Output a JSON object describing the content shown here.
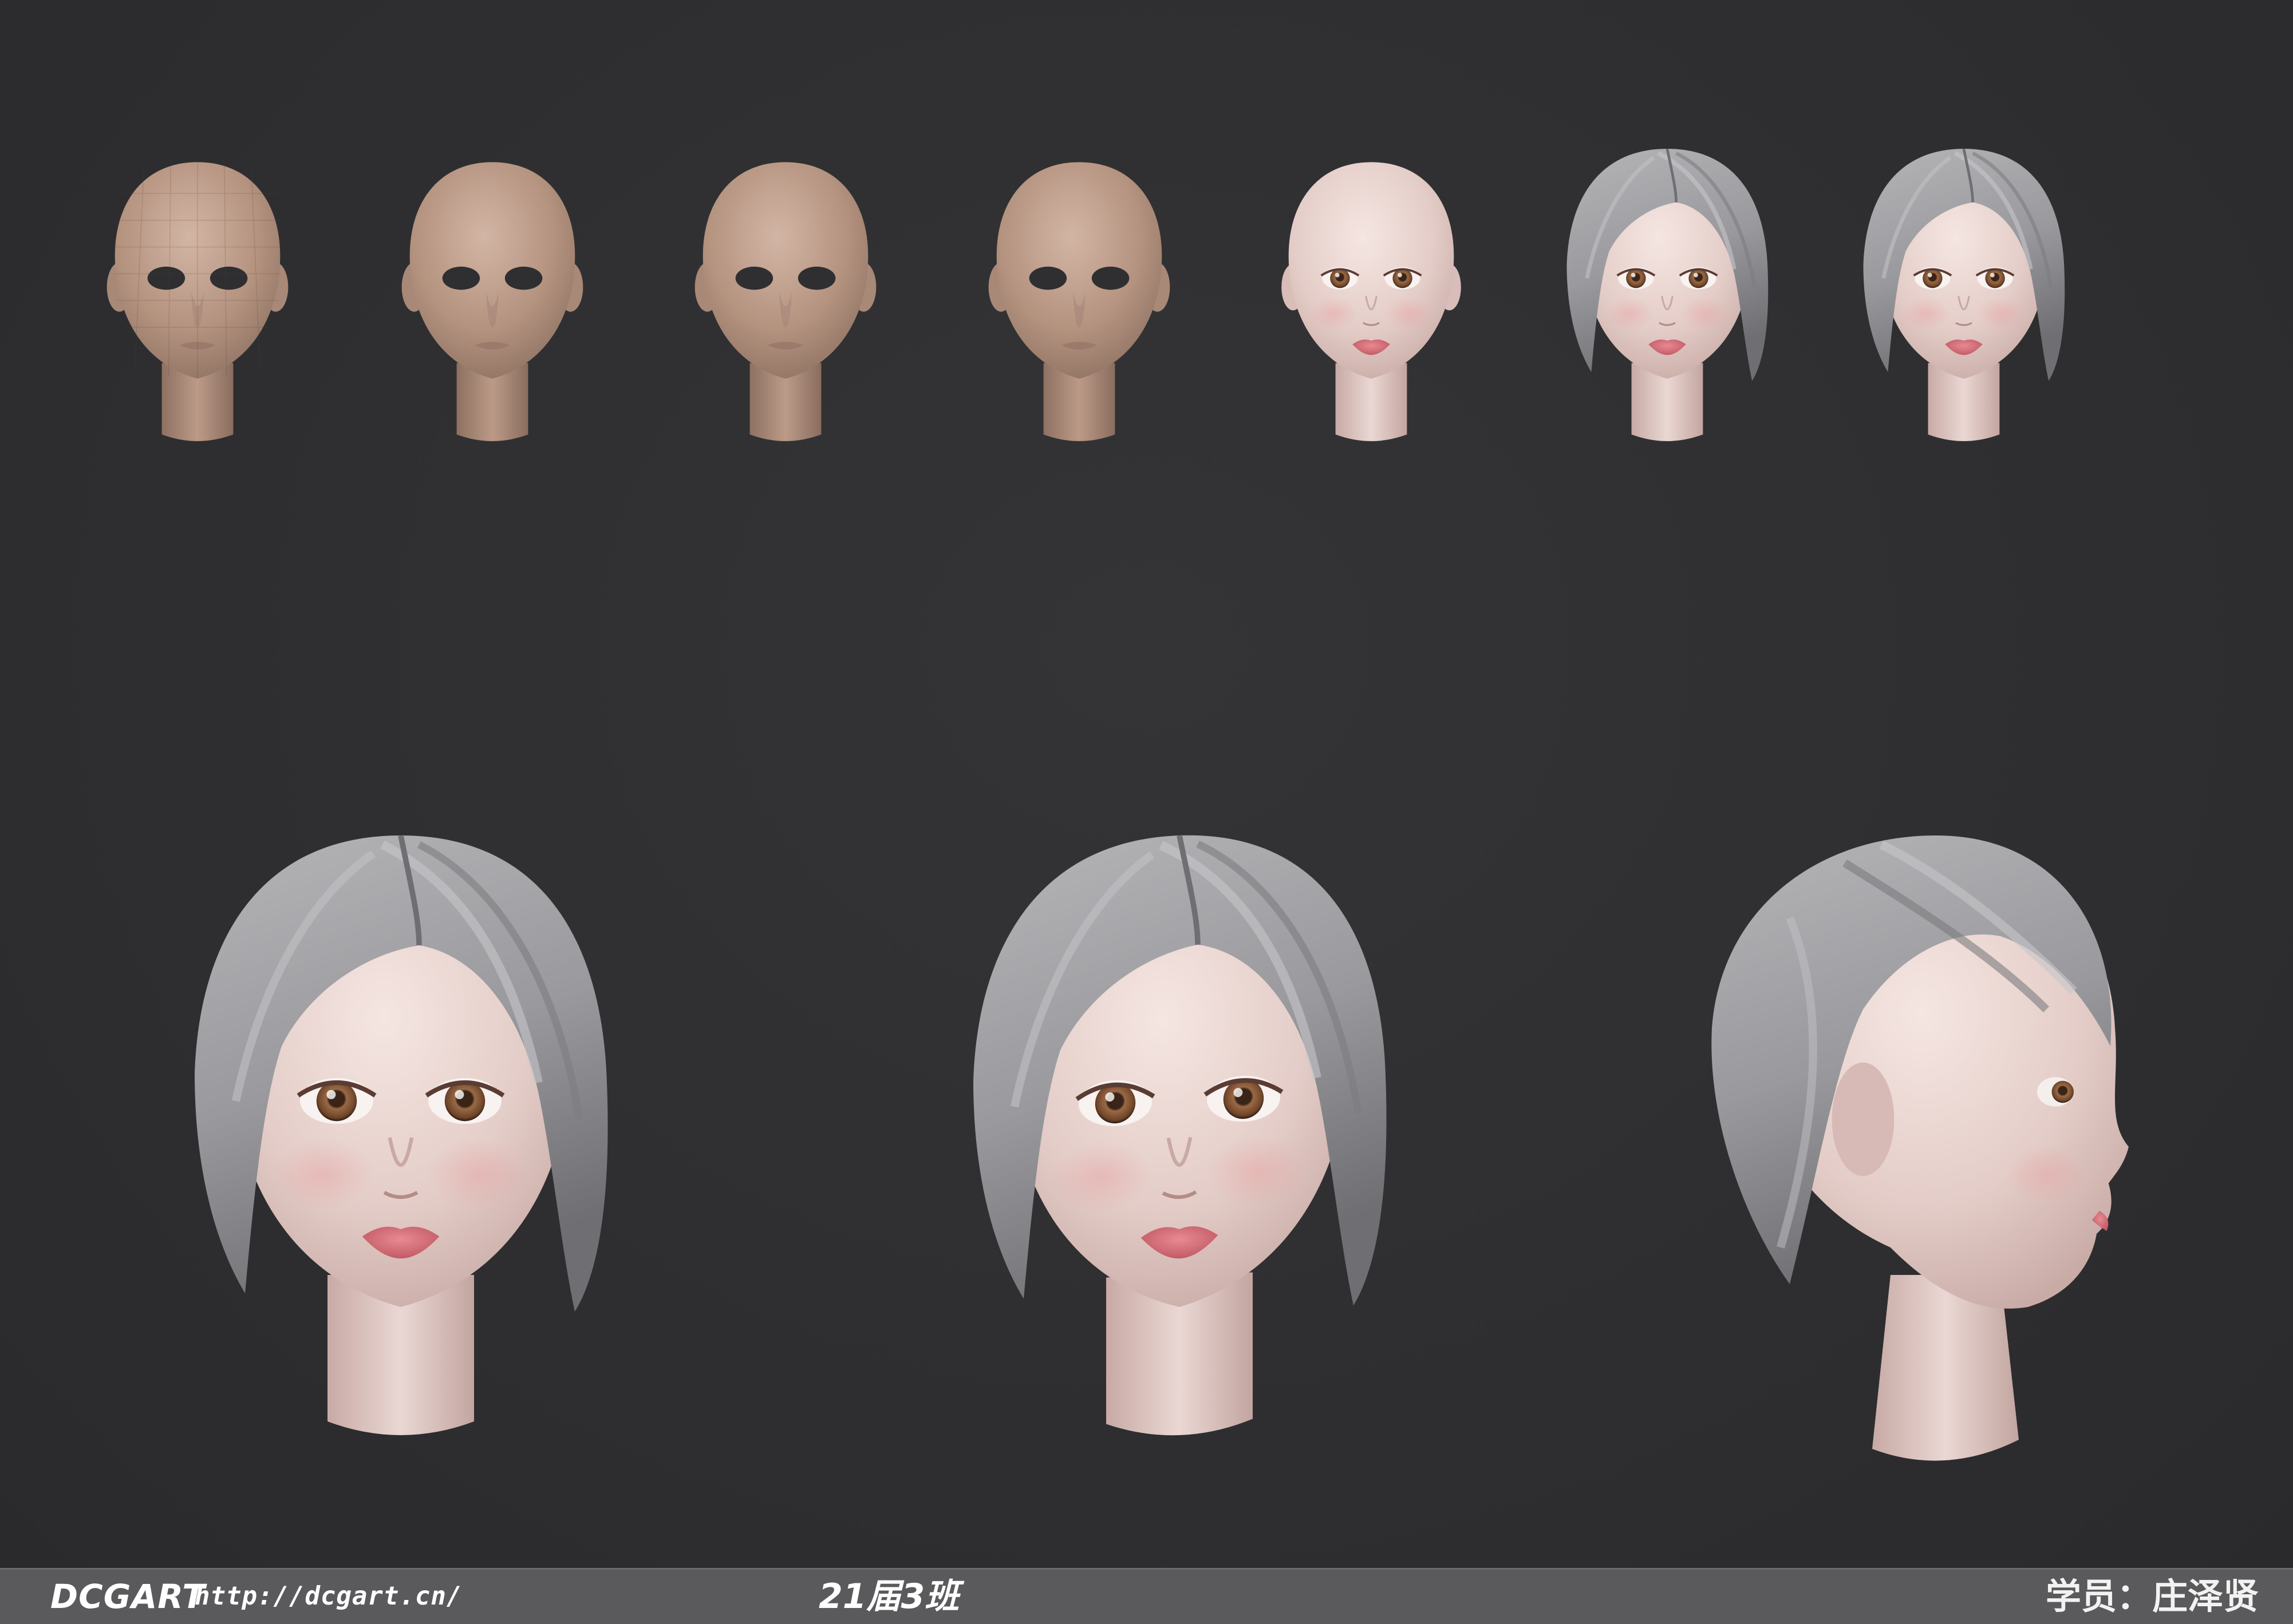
{
  "footer": {
    "brand": "DCGART",
    "url": "http://dcgart.cn/",
    "class_label": "21届3班",
    "student": "学员：庄泽贤"
  },
  "colors": {
    "background": "#2f2f31",
    "clay": "#b8998a",
    "skin": "#e6d3cf",
    "hair": "#9a9a9e",
    "lips": "#d9707a",
    "iris": "#8a5a3a",
    "footer_bar": "#5a5a5c"
  },
  "stages": [
    {
      "name": "base-mesh-head",
      "material": "clay-blocky"
    },
    {
      "name": "refined-clay-head",
      "material": "clay"
    },
    {
      "name": "detailed-clay-head",
      "material": "clay"
    },
    {
      "name": "final-clay-head",
      "material": "clay"
    },
    {
      "name": "textured-head",
      "material": "skin"
    },
    {
      "name": "head-with-hair-side",
      "material": "skin-hair"
    },
    {
      "name": "head-with-hair-front",
      "material": "skin-hair"
    }
  ],
  "large_views": [
    {
      "name": "front-view",
      "material": "skin-hair"
    },
    {
      "name": "three-quarter-view",
      "material": "skin-hair"
    },
    {
      "name": "profile-view",
      "material": "skin-hair"
    }
  ]
}
